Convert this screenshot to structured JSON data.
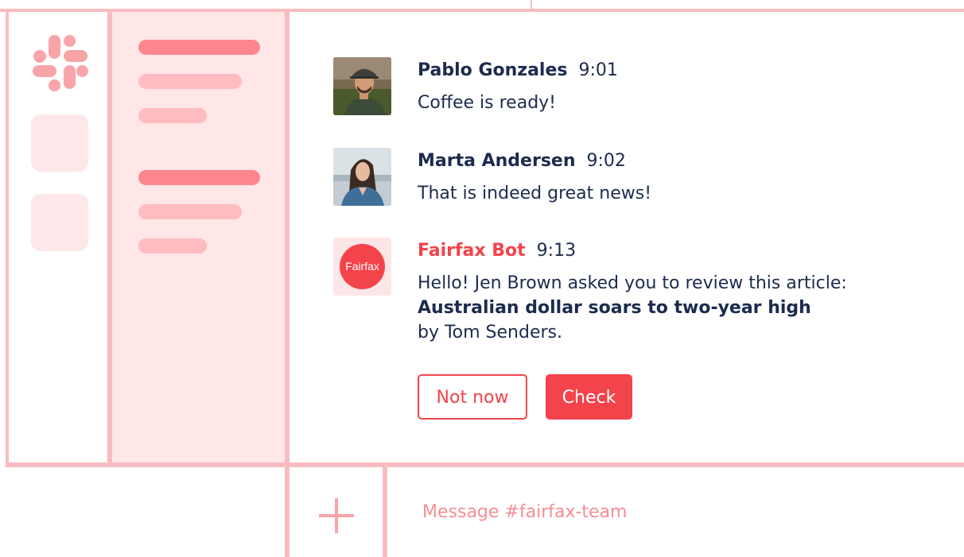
{
  "workspace": {
    "logo_icon": "slack-logo",
    "accent_color": "#f3434b"
  },
  "messages": [
    {
      "author": "Pablo Gonzales",
      "time": "9:01",
      "text": "Coffee is ready!",
      "avatar": "photo"
    },
    {
      "author": "Marta Andersen",
      "time": "9:02",
      "text": "That is indeed great news!",
      "avatar": "photo"
    },
    {
      "author": "Fairfax Bot",
      "time": "9:13",
      "avatar_label": "Fairfax",
      "text_line1": "Hello! Jen Brown asked you to review this article:",
      "article_title": "Australian dollar soars to two-year high",
      "text_line3": "by Tom Senders.",
      "actions": {
        "not_now_label": "Not now",
        "check_label": "Check"
      }
    }
  ],
  "composer": {
    "add_icon": "plus-icon",
    "placeholder": "Message #fairfax-team"
  }
}
